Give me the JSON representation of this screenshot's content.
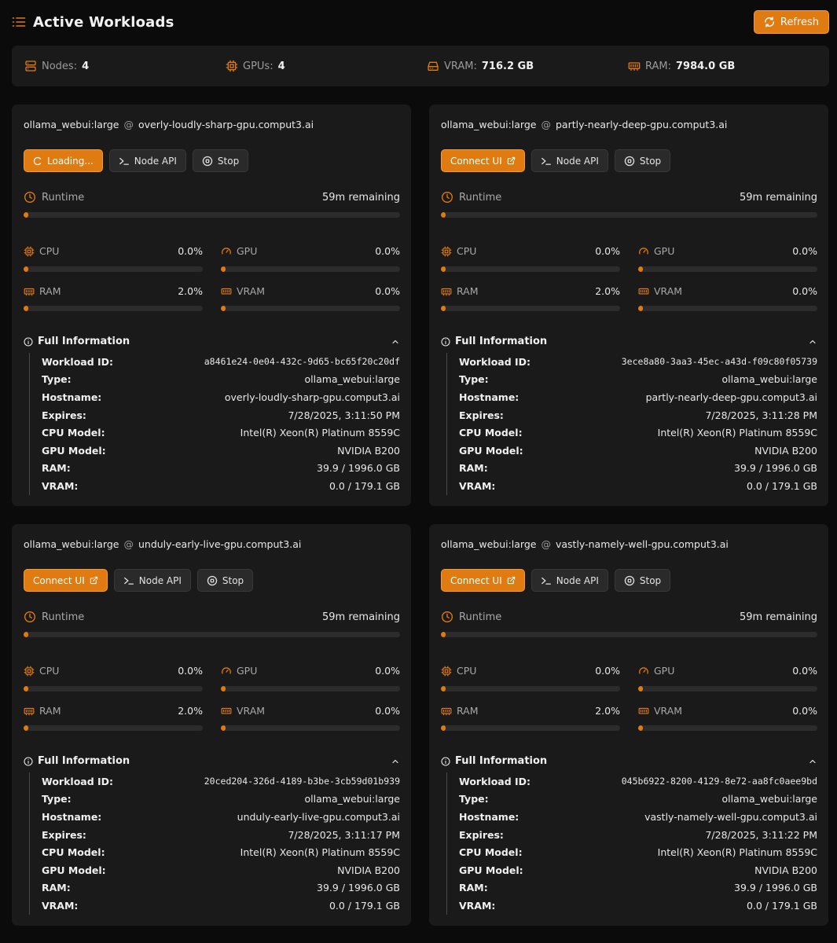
{
  "header": {
    "title": "Active Workloads",
    "refresh_label": "Refresh"
  },
  "colors": {
    "accent": "#e07b11",
    "background": "#0b0b0b",
    "card": "#1a1a1a"
  },
  "stats": [
    {
      "label": "Nodes:",
      "value": "4",
      "icon": "server-icon"
    },
    {
      "label": "GPUs:",
      "value": "4",
      "icon": "cpu-chip-icon"
    },
    {
      "label": "VRAM:",
      "value": "716.2 GB",
      "icon": "drive-icon"
    },
    {
      "label": "RAM:",
      "value": "7984.0 GB",
      "icon": "memory-icon"
    }
  ],
  "workloads": [
    {
      "type": "ollama_webui:large",
      "at": "@",
      "host": "overly-loudly-sharp-gpu.comput3.ai",
      "primary_label": "Loading...",
      "node_api_label": "Node API",
      "stop_label": "Stop",
      "runtime_label": "Runtime",
      "remaining": "59m remaining",
      "runtime_fraction": 0.01,
      "metrics": {
        "cpu": {
          "label": "CPU",
          "value": "0.0%",
          "fraction": 0.0
        },
        "gpu": {
          "label": "GPU",
          "value": "0.0%",
          "fraction": 0.0
        },
        "ram": {
          "label": "RAM",
          "value": "2.0%",
          "fraction": 0.02
        },
        "vram": {
          "label": "VRAM",
          "value": "0.0%",
          "fraction": 0.0
        }
      },
      "info_title": "Full Information",
      "info": [
        {
          "k": "Workload ID:",
          "v": "a8461e24-0e04-432c-9d65-bc65f20c20df"
        },
        {
          "k": "Type:",
          "v": "ollama_webui:large"
        },
        {
          "k": "Hostname:",
          "v": "overly-loudly-sharp-gpu.comput3.ai"
        },
        {
          "k": "Expires:",
          "v": "7/28/2025, 3:11:50 PM"
        },
        {
          "k": "CPU Model:",
          "v": "Intel(R) Xeon(R) Platinum 8559C"
        },
        {
          "k": "GPU Model:",
          "v": "NVIDIA B200"
        },
        {
          "k": "RAM:",
          "v": "39.9 / 1996.0 GB"
        },
        {
          "k": "VRAM:",
          "v": "0.0 / 179.1 GB"
        }
      ]
    },
    {
      "type": "ollama_webui:large",
      "at": "@",
      "host": "partly-nearly-deep-gpu.comput3.ai",
      "primary_label": "Connect UI",
      "node_api_label": "Node API",
      "stop_label": "Stop",
      "runtime_label": "Runtime",
      "remaining": "59m remaining",
      "runtime_fraction": 0.01,
      "metrics": {
        "cpu": {
          "label": "CPU",
          "value": "0.0%",
          "fraction": 0.0
        },
        "gpu": {
          "label": "GPU",
          "value": "0.0%",
          "fraction": 0.0
        },
        "ram": {
          "label": "RAM",
          "value": "2.0%",
          "fraction": 0.02
        },
        "vram": {
          "label": "VRAM",
          "value": "0.0%",
          "fraction": 0.0
        }
      },
      "info_title": "Full Information",
      "info": [
        {
          "k": "Workload ID:",
          "v": "3ece8a80-3aa3-45ec-a43d-f09c80f05739"
        },
        {
          "k": "Type:",
          "v": "ollama_webui:large"
        },
        {
          "k": "Hostname:",
          "v": "partly-nearly-deep-gpu.comput3.ai"
        },
        {
          "k": "Expires:",
          "v": "7/28/2025, 3:11:28 PM"
        },
        {
          "k": "CPU Model:",
          "v": "Intel(R) Xeon(R) Platinum 8559C"
        },
        {
          "k": "GPU Model:",
          "v": "NVIDIA B200"
        },
        {
          "k": "RAM:",
          "v": "39.9 / 1996.0 GB"
        },
        {
          "k": "VRAM:",
          "v": "0.0 / 179.1 GB"
        }
      ]
    },
    {
      "type": "ollama_webui:large",
      "at": "@",
      "host": "unduly-early-live-gpu.comput3.ai",
      "primary_label": "Connect UI",
      "node_api_label": "Node API",
      "stop_label": "Stop",
      "runtime_label": "Runtime",
      "remaining": "59m remaining",
      "runtime_fraction": 0.01,
      "metrics": {
        "cpu": {
          "label": "CPU",
          "value": "0.0%",
          "fraction": 0.0
        },
        "gpu": {
          "label": "GPU",
          "value": "0.0%",
          "fraction": 0.0
        },
        "ram": {
          "label": "RAM",
          "value": "2.0%",
          "fraction": 0.02
        },
        "vram": {
          "label": "VRAM",
          "value": "0.0%",
          "fraction": 0.0
        }
      },
      "info_title": "Full Information",
      "info": [
        {
          "k": "Workload ID:",
          "v": "20ced204-326d-4189-b3be-3cb59d01b939"
        },
        {
          "k": "Type:",
          "v": "ollama_webui:large"
        },
        {
          "k": "Hostname:",
          "v": "unduly-early-live-gpu.comput3.ai"
        },
        {
          "k": "Expires:",
          "v": "7/28/2025, 3:11:17 PM"
        },
        {
          "k": "CPU Model:",
          "v": "Intel(R) Xeon(R) Platinum 8559C"
        },
        {
          "k": "GPU Model:",
          "v": "NVIDIA B200"
        },
        {
          "k": "RAM:",
          "v": "39.9 / 1996.0 GB"
        },
        {
          "k": "VRAM:",
          "v": "0.0 / 179.1 GB"
        }
      ]
    },
    {
      "type": "ollama_webui:large",
      "at": "@",
      "host": "vastly-namely-well-gpu.comput3.ai",
      "primary_label": "Connect UI",
      "node_api_label": "Node API",
      "stop_label": "Stop",
      "runtime_label": "Runtime",
      "remaining": "59m remaining",
      "runtime_fraction": 0.01,
      "metrics": {
        "cpu": {
          "label": "CPU",
          "value": "0.0%",
          "fraction": 0.0
        },
        "gpu": {
          "label": "GPU",
          "value": "0.0%",
          "fraction": 0.0
        },
        "ram": {
          "label": "RAM",
          "value": "2.0%",
          "fraction": 0.02
        },
        "vram": {
          "label": "VRAM",
          "value": "0.0%",
          "fraction": 0.0
        }
      },
      "info_title": "Full Information",
      "info": [
        {
          "k": "Workload ID:",
          "v": "045b6922-8200-4129-8e72-aa8fc0aee9bd"
        },
        {
          "k": "Type:",
          "v": "ollama_webui:large"
        },
        {
          "k": "Hostname:",
          "v": "vastly-namely-well-gpu.comput3.ai"
        },
        {
          "k": "Expires:",
          "v": "7/28/2025, 3:11:22 PM"
        },
        {
          "k": "CPU Model:",
          "v": "Intel(R) Xeon(R) Platinum 8559C"
        },
        {
          "k": "GPU Model:",
          "v": "NVIDIA B200"
        },
        {
          "k": "RAM:",
          "v": "39.9 / 1996.0 GB"
        },
        {
          "k": "VRAM:",
          "v": "0.0 / 179.1 GB"
        }
      ]
    }
  ]
}
